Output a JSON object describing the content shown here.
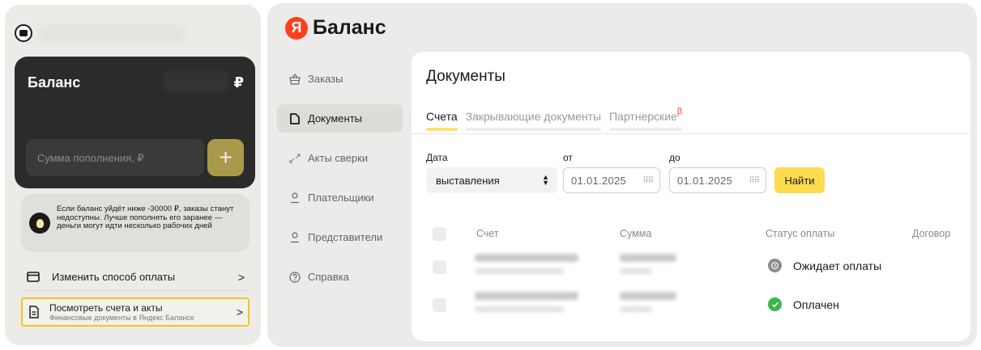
{
  "widget": {
    "balance_title": "Баланс",
    "currency_symbol": "₽",
    "amount_placeholder": "Сумма пополнения, ₽",
    "plus_label": "+",
    "notice_text": "Если баланс уйдёт ниже -30000 ₽, заказы станут недоступны. Лучше пополнять его заранее — деньги могут идти несколько рабочих дней",
    "change_payment_label": "Изменить способ оплаты",
    "view_docs_title": "Посмотреть счета и акты",
    "view_docs_subtitle": "Финансовые документы в Яндекс Балансе",
    "chevron": ">"
  },
  "app": {
    "logo_letter": "Я",
    "logo_text": "Баланс",
    "nav": [
      {
        "label": "Заказы",
        "icon": "basket-icon"
      },
      {
        "label": "Документы",
        "icon": "document-icon",
        "active": true
      },
      {
        "label": "Акты сверки",
        "icon": "arrows-icon"
      },
      {
        "label": "Плательщики",
        "icon": "person-icon"
      },
      {
        "label": "Представители",
        "icon": "person-icon"
      },
      {
        "label": "Справка",
        "icon": "help-icon"
      }
    ],
    "page_title": "Документы",
    "tabs": [
      {
        "label": "Счета",
        "active": true
      },
      {
        "label": "Закрывающие документы"
      },
      {
        "label": "Партнерские",
        "badge": "β"
      }
    ],
    "filters": {
      "date_label": "Дата",
      "from_label": "от",
      "to_label": "до",
      "date_type": "выставления",
      "date_from": "01.01.2025",
      "date_to": "01.01.2025",
      "find_label": "Найти"
    },
    "table": {
      "headers": [
        "Счет",
        "Сумма",
        "Статус оплаты",
        "Договор"
      ],
      "rows": [
        {
          "status": "Ожидает оплаты",
          "status_icon": "clock-icon",
          "status_color": "#8c8c8c"
        },
        {
          "status": "Оплачен",
          "status_icon": "check-icon",
          "status_color": "#3bb54a"
        }
      ]
    }
  },
  "colors": {
    "accent_yellow": "#ffdb4d",
    "brand_red": "#fc3f1d",
    "card_dark": "#2b2b2b",
    "plus_button": "#a89a4a"
  }
}
